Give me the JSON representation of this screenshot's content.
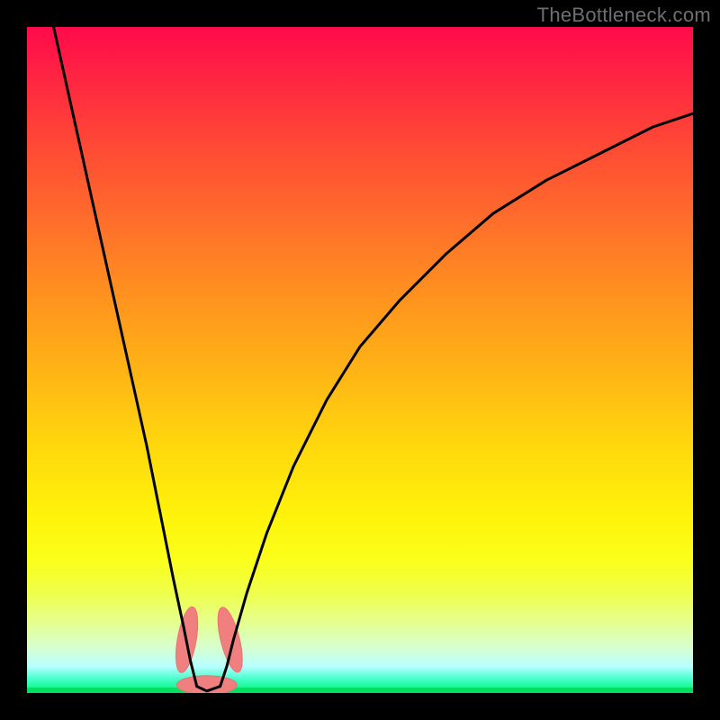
{
  "watermark": "TheBottleneck.com",
  "chart_data": {
    "type": "line",
    "title": "",
    "xlabel": "",
    "ylabel": "",
    "xlim": [
      0,
      100
    ],
    "ylim": [
      0,
      100
    ],
    "grid": false,
    "legend": false,
    "series": [
      {
        "name": "curve-left",
        "x": [
          4,
          6,
          8,
          10,
          12,
          14,
          16,
          18,
          20,
          22,
          23.5,
          24.5,
          25.5
        ],
        "values": [
          100,
          91,
          82,
          73,
          64,
          55,
          46,
          37,
          27,
          17,
          10,
          5,
          1
        ]
      },
      {
        "name": "curve-right",
        "x": [
          29,
          30,
          31,
          33,
          36,
          40,
          45,
          50,
          56,
          63,
          70,
          78,
          86,
          94,
          100
        ],
        "values": [
          1,
          4,
          8,
          15,
          24,
          34,
          44,
          52,
          59,
          66,
          72,
          77,
          81,
          85,
          87
        ]
      },
      {
        "name": "dip-floor",
        "x": [
          25.5,
          27,
          29
        ],
        "values": [
          1,
          0.3,
          1
        ]
      }
    ],
    "markers": [
      {
        "name": "lobe-left",
        "cx": 24.0,
        "cy": 8.0,
        "rx": 1.4,
        "ry": 5.0,
        "rot": 10
      },
      {
        "name": "lobe-right",
        "cx": 30.5,
        "cy": 8.0,
        "rx": 1.4,
        "ry": 5.0,
        "rot": -14
      },
      {
        "name": "lobe-base",
        "cx": 27.0,
        "cy": 1.2,
        "rx": 4.5,
        "ry": 1.4,
        "rot": 0
      }
    ],
    "colors": {
      "curve": "#000000",
      "marker_fill": "#f08080",
      "marker_stroke": "#e57373",
      "gradient_top": "#ff0a4a",
      "gradient_bottom": "#00f06a"
    }
  }
}
